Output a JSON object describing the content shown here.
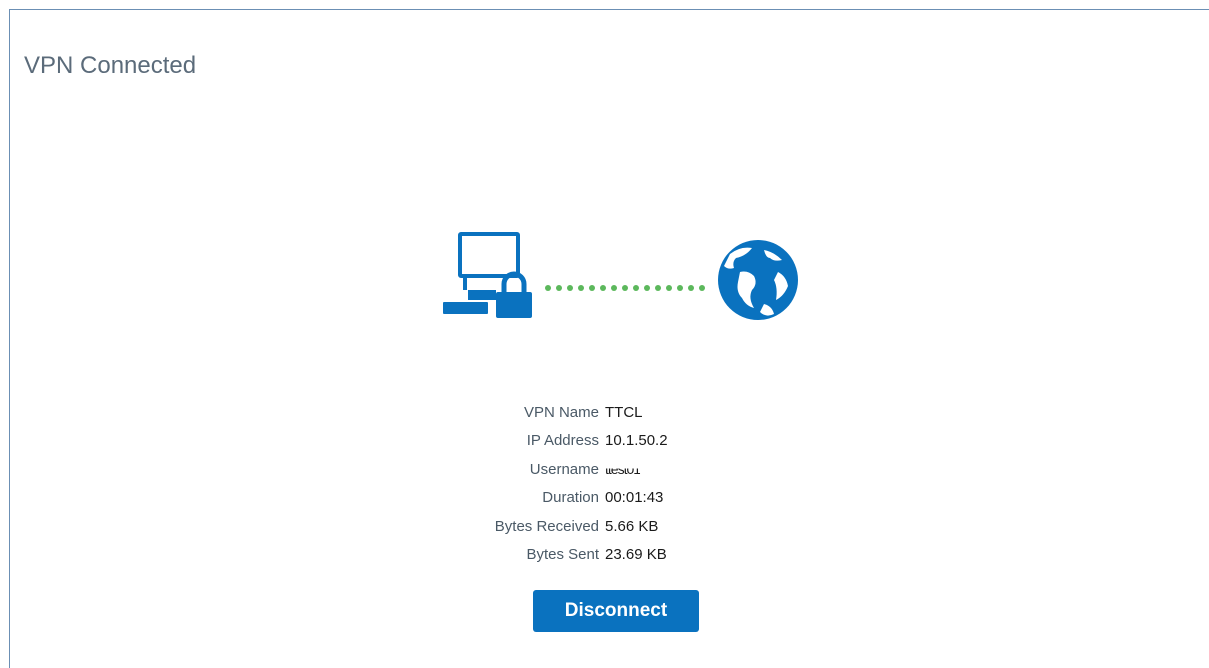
{
  "header": {
    "title": "VPN Connected"
  },
  "details": {
    "rows": [
      {
        "label": "VPN Name",
        "value": "TTCL"
      },
      {
        "label": "IP Address",
        "value": "10.1.50.2"
      },
      {
        "label": "Username",
        "value": "ttest01"
      },
      {
        "label": "Duration",
        "value": "00:01:43"
      },
      {
        "label": "Bytes Received",
        "value": "5.66 KB"
      },
      {
        "label": "Bytes Sent",
        "value": "23.69 KB"
      }
    ]
  },
  "actions": {
    "disconnect_label": "Disconnect"
  },
  "colors": {
    "icon_blue": "#0a72bf",
    "connection_dots": "#5cb85c",
    "label_gray": "#4a5966"
  },
  "icons": {
    "computer": "computer-lock-icon",
    "connection": "connection-dots",
    "globe": "globe-icon"
  }
}
